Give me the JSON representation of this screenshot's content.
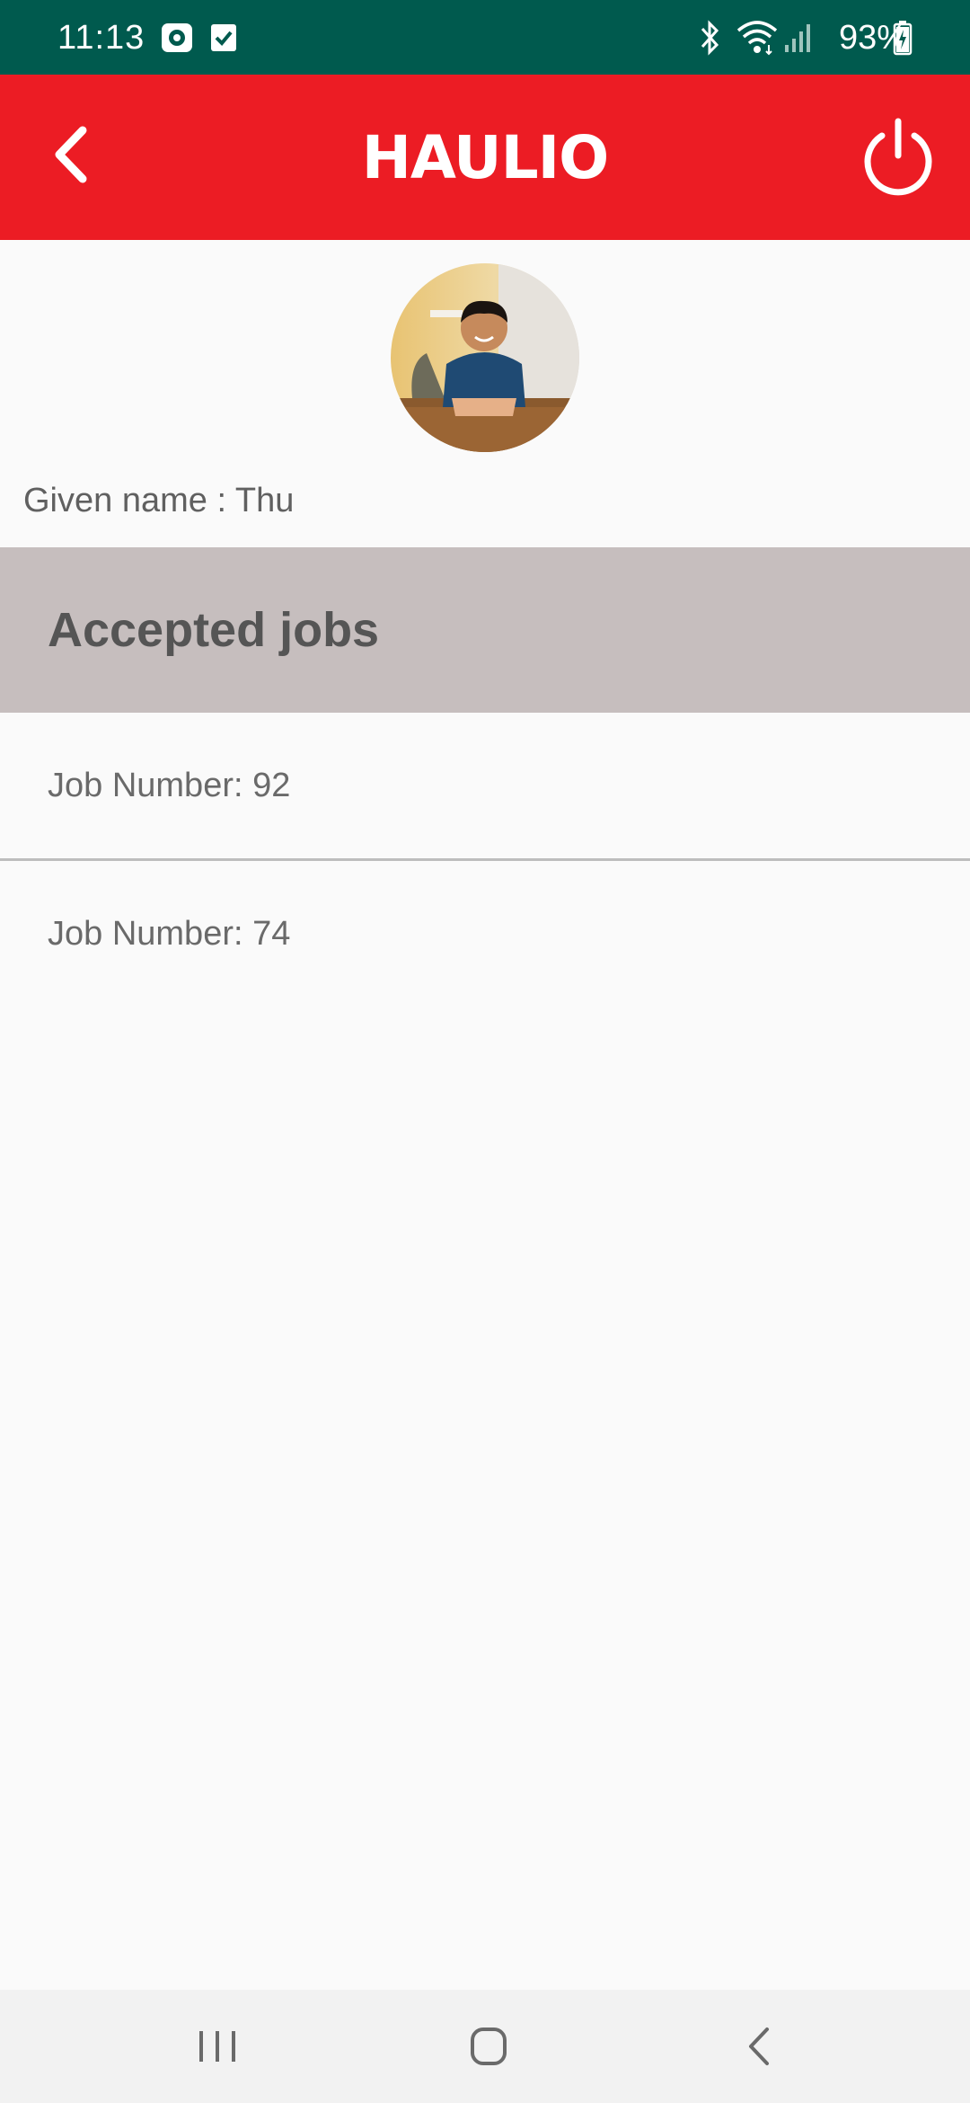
{
  "status_bar": {
    "time": "11:13",
    "battery": "93%",
    "icons": [
      "camera-icon",
      "checkbox-icon",
      "bluetooth-icon",
      "wifi-icon",
      "signal-icon",
      "battery-icon"
    ],
    "background_color": "#005a4e"
  },
  "app_bar": {
    "logo_text": "HAULIO",
    "back_icon": "chevron-left-icon",
    "power_icon": "power-icon",
    "background_color": "#ec1c24"
  },
  "profile": {
    "given_name_label": "Given name : ",
    "given_name_value": "Thu"
  },
  "accepted_jobs": {
    "title": "Accepted jobs",
    "jobs": [
      {
        "label": "Job Number: 92"
      },
      {
        "label": "Job Number: 74"
      }
    ],
    "header_color": "#c6bebe"
  },
  "nav_bar": {
    "icons": [
      "recent-apps-icon",
      "home-icon",
      "back-icon"
    ]
  }
}
